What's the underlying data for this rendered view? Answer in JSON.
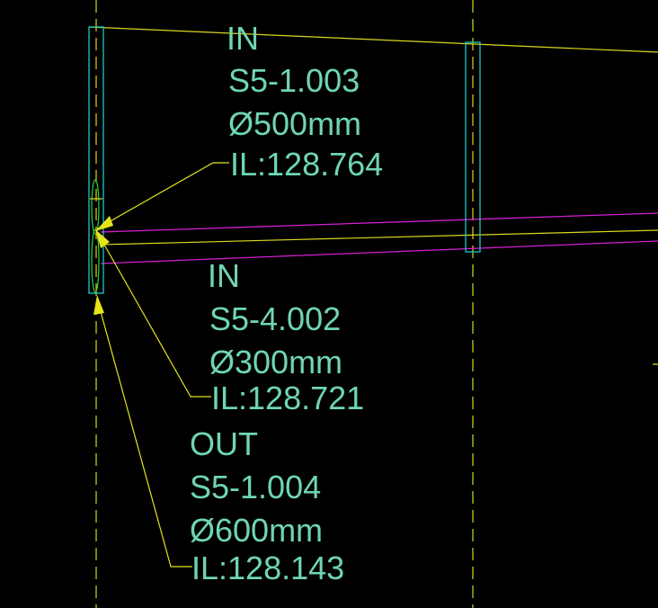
{
  "colors": {
    "background": "#000000",
    "text": "#6fd6b0",
    "leader": "#e4e41a",
    "pipe_centerline": "#d8d81e",
    "pipe_edge": "#d21fd2",
    "manhole": "#20c8c8",
    "gridline": "#d8d81e"
  },
  "annotations": [
    {
      "id": "in-1",
      "direction": "IN",
      "pipe_ref": "S5-1.003",
      "diameter": "Ø500mm",
      "invert_level": "IL:128.764"
    },
    {
      "id": "in-2",
      "direction": "IN",
      "pipe_ref": "S5-4.002",
      "diameter": "Ø300mm",
      "invert_level": "IL:128.721"
    },
    {
      "id": "out-1",
      "direction": "OUT",
      "pipe_ref": "S5-1.004",
      "diameter": "Ø600mm",
      "invert_level": "IL:128.143"
    }
  ]
}
